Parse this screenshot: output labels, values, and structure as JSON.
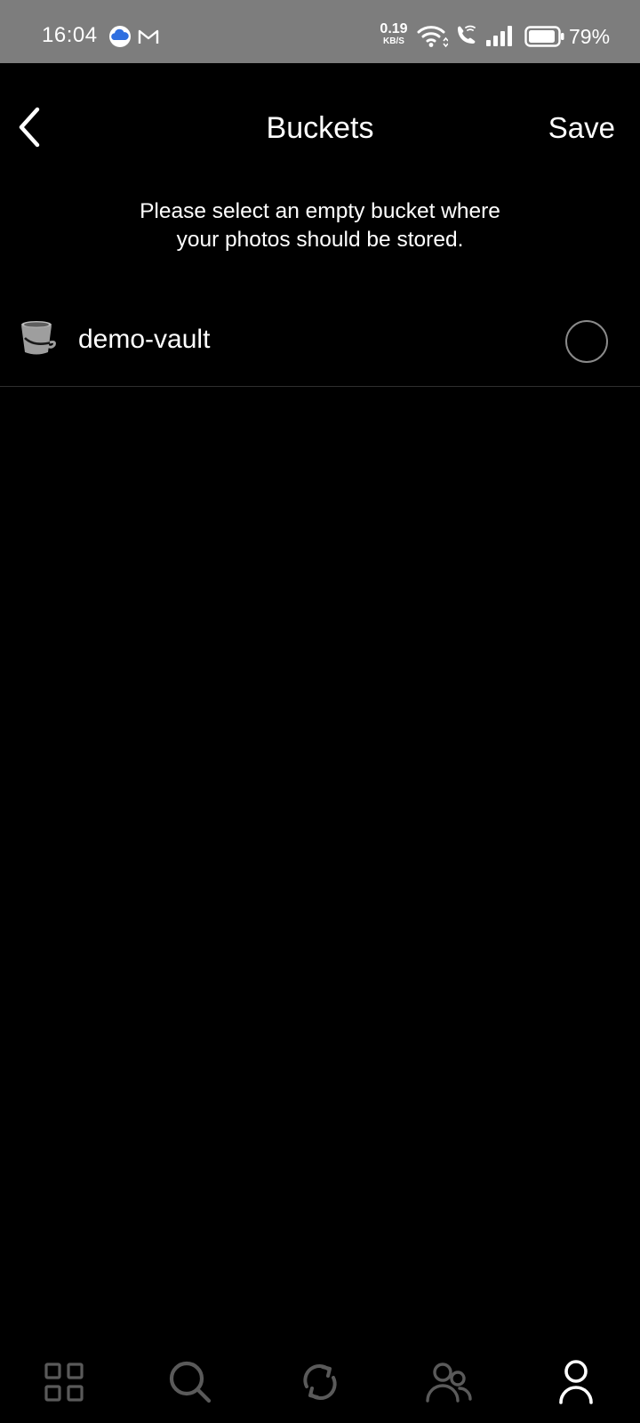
{
  "status_bar": {
    "time": "16:04",
    "net_speed_value": "0.19",
    "net_speed_unit": "KB/S",
    "battery_percent": "79%",
    "icons": [
      "cloud-icon",
      "gmail-icon",
      "wifi-icon",
      "wifi-call-icon",
      "signal-icon",
      "battery-icon"
    ],
    "cloud_color": "#2f6fe0"
  },
  "header": {
    "title": "Buckets",
    "save_label": "Save",
    "back_icon": "chevron-left-icon"
  },
  "subtitle": {
    "line1": "Please select an empty bucket where",
    "line2": "your photos should be stored."
  },
  "buckets": [
    {
      "name": "demo-vault",
      "icon": "bucket-icon",
      "selected": false
    }
  ],
  "bottom_nav": {
    "items": [
      {
        "icon": "grid-icon",
        "active": false
      },
      {
        "icon": "search-icon",
        "active": false
      },
      {
        "icon": "sync-icon",
        "active": false
      },
      {
        "icon": "people-icon",
        "active": false
      },
      {
        "icon": "person-icon",
        "active": true
      }
    ],
    "inactive_color": "#5a5a5a",
    "active_color": "#ffffff"
  }
}
